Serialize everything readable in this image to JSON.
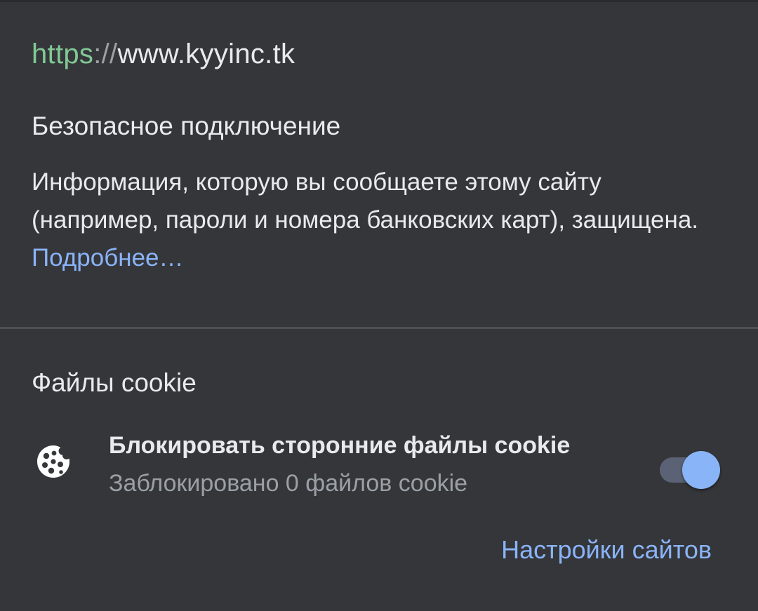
{
  "url": {
    "scheme": "https",
    "separator": "://",
    "host": "www.kyyinc.tk"
  },
  "connection": {
    "title": "Безопасное подключение",
    "description": "Информация, которую вы сообщаете этому сайту (например, пароли и номера банковских карт), защищена.",
    "learn_more": "Подробнее…"
  },
  "cookies": {
    "title": "Файлы cookie",
    "block_label": "Блокировать сторонние файлы cookie",
    "blocked_status": "Заблокировано 0 файлов cookie",
    "toggle_on": true,
    "icon": "cookie-icon"
  },
  "footer": {
    "site_settings": "Настройки сайтов"
  },
  "colors": {
    "background": "#35363a",
    "text": "#e8eaed",
    "secondary_text": "#9aa0a6",
    "https_green": "#81c995",
    "link_blue": "#8ab4f8",
    "toggle_track": "#5b6275"
  }
}
